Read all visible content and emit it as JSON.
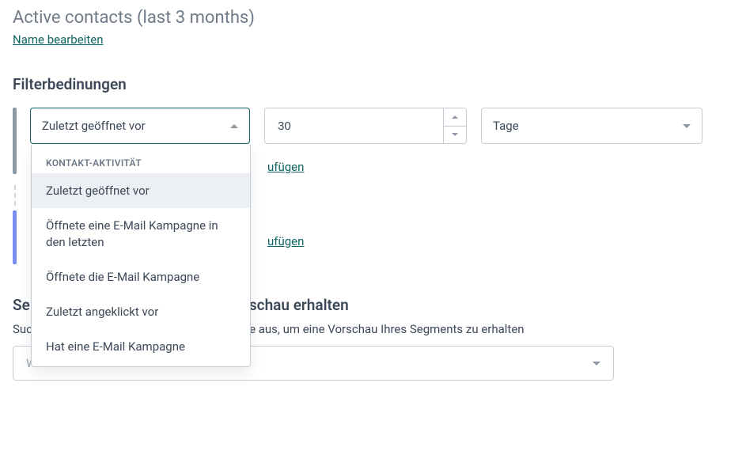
{
  "header": {
    "title": "Active contacts (last 3 months)",
    "edit_name_link": "Name bearbeiten"
  },
  "filters": {
    "heading": "Filterbedinungen",
    "condition_field": {
      "value": "Zuletzt geöffnet vor",
      "group_label": "KONTAKT-AKTIVITÄT",
      "options": [
        "Zuletzt geöffnet vor",
        "Öffnete eine E-Mail Kampagne in den letzten",
        "Öffnete die E-Mail Kampagne",
        "Zuletzt angeklickt vor",
        "Hat eine E-Mail Kampagne"
      ]
    },
    "number_field": {
      "value": "30"
    },
    "unit_field": {
      "value": "Tage"
    },
    "add_link_1": "ufügen",
    "add_link_2": "ufügen"
  },
  "preview": {
    "heading_visible": "orschau erhalten",
    "heading_left_fragment": "Se",
    "desc_left_fragment": "Sucl",
    "desc_visible": "te aus, um eine Vorschau Ihres Segments zu erhalten",
    "list_select_placeholder": "Wählen"
  }
}
